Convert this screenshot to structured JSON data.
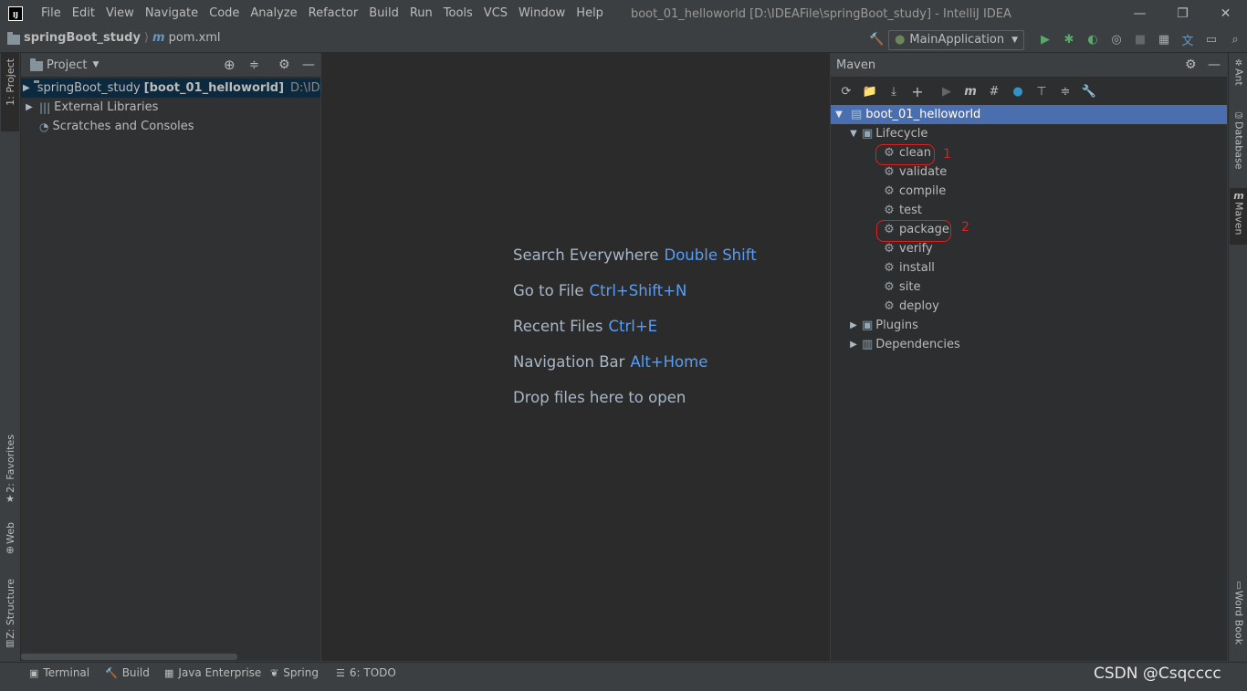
{
  "app": {
    "logo_text": "IJ",
    "window_title": "boot_01_helloworld [D:\\IDEAFile\\springBoot_study] - IntelliJ IDEA",
    "menu": [
      "File",
      "Edit",
      "View",
      "Navigate",
      "Code",
      "Analyze",
      "Refactor",
      "Build",
      "Run",
      "Tools",
      "VCS",
      "Window",
      "Help"
    ],
    "window_controls": {
      "minimize": "—",
      "restore": "❐",
      "close": "✕"
    }
  },
  "navbar": {
    "project": "springBoot_study",
    "separator": "⟩",
    "file": "pom.xml",
    "run_config": "MainApplication"
  },
  "left_stripe": {
    "project_tab": "1: Project",
    "favorites_tab": "2: Favorites",
    "web_tab": "Web",
    "structure_tab": "Z: Structure"
  },
  "project_panel": {
    "title": "Project",
    "tree": [
      {
        "label": "springBoot_study",
        "bold": "[boot_01_helloworld]",
        "path": "D:\\IDEAF"
      },
      {
        "label": "External Libraries"
      },
      {
        "label": "Scratches and Consoles"
      }
    ]
  },
  "editor": {
    "hints": [
      {
        "text": "Search Everywhere",
        "key": "Double Shift"
      },
      {
        "text": "Go to File",
        "key": "Ctrl+Shift+N"
      },
      {
        "text": "Recent Files",
        "key": "Ctrl+E"
      },
      {
        "text": "Navigation Bar",
        "key": "Alt+Home"
      },
      {
        "text": "Drop files here to open",
        "key": ""
      }
    ]
  },
  "maven_panel": {
    "title": "Maven",
    "root": "boot_01_helloworld",
    "lifecycle_label": "Lifecycle",
    "lifecycle": [
      "clean",
      "validate",
      "compile",
      "test",
      "package",
      "verify",
      "install",
      "site",
      "deploy"
    ],
    "plugins_label": "Plugins",
    "dependencies_label": "Dependencies",
    "annotations": [
      "1",
      "2"
    ]
  },
  "right_stripe": {
    "ant": "Ant",
    "database": "Database",
    "maven": "Maven",
    "wordbook": "Word Book"
  },
  "bottom_bar": {
    "tabs": [
      "Terminal",
      "Build",
      "Java Enterprise",
      "Spring",
      "6: TODO"
    ],
    "watermark": "CSDN @Csqcccc"
  },
  "colors": {
    "accent": "#4b6eaf",
    "key_hint": "#589df6",
    "annotation": "#e02020"
  }
}
